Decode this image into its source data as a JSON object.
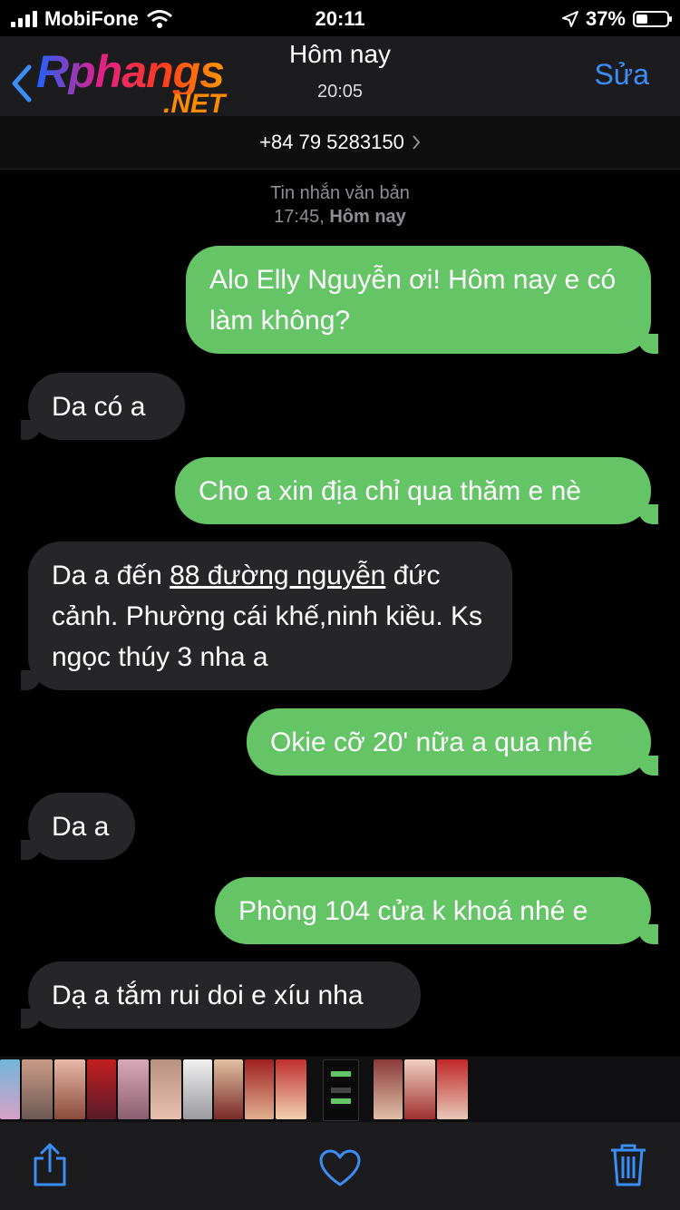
{
  "status": {
    "carrier": "MobiFone",
    "time": "20:11",
    "battery_percent": "37%",
    "battery_level": 0.37
  },
  "header": {
    "title": "Hôm nay",
    "subtitle": "20:05",
    "edit_label": "Sửa",
    "logo_main": "Rphangs",
    "logo_sub": ".NET"
  },
  "contact": {
    "number": "+84 79 5283150"
  },
  "thread_meta": {
    "type": "Tin nhắn văn bản",
    "time_prefix": "17:45,",
    "time_day": "Hôm nay"
  },
  "messages": [
    {
      "from": "me",
      "text": "Alo Elly Nguyễn ơi! Hôm nay e có làm không?"
    },
    {
      "from": "them",
      "text": "Da có a"
    },
    {
      "from": "me",
      "text": "Cho a xin địa chỉ qua thăm e nè"
    },
    {
      "from": "them",
      "text_before": "Da a đến ",
      "link": "88 đường nguyễn",
      "text_after": " đức cảnh. Phường cái khế,ninh kiều. Ks ngọc thúy 3 nha a"
    },
    {
      "from": "me",
      "text": "Okie cỡ 20' nữa a qua nhé"
    },
    {
      "from": "them",
      "text": "Da a"
    },
    {
      "from": "me",
      "text": "Phòng 104 cửa k khoá nhé e"
    },
    {
      "from": "them",
      "text": "Dạ a tắm rui doi e xíu nha"
    }
  ],
  "icons": [
    "back-chevron-icon",
    "chevron-right-icon",
    "wifi-icon",
    "location-arrow-icon",
    "share-icon",
    "heart-icon",
    "trash-icon"
  ],
  "colors": {
    "sent": "#64c466",
    "received": "#262628",
    "accent": "#3a8ef7"
  }
}
